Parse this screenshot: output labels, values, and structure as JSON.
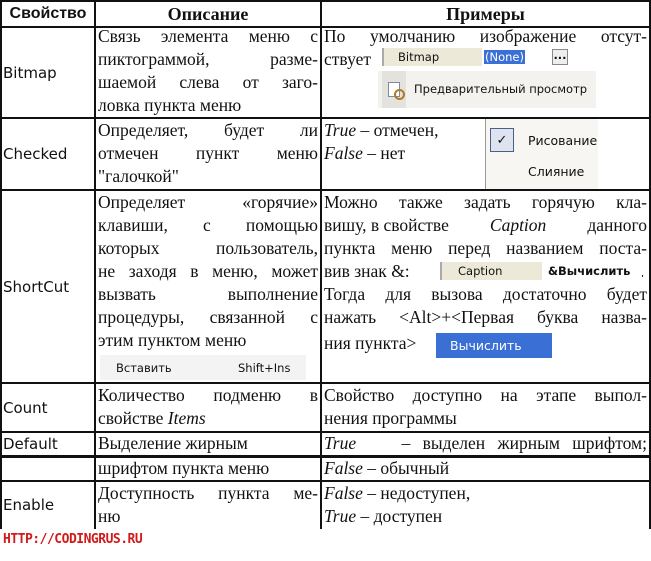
{
  "headers": {
    "property": "Свойство",
    "description": "Описание",
    "examples": "Примеры"
  },
  "rows": {
    "bitmap": {
      "property": "Bitmap",
      "desc": [
        "Связь элемента меню с",
        "пиктограммой, разме-",
        "шаемой слева от заго-",
        "ловка пункта меню"
      ],
      "ex": [
        "По умолчанию изображение отсут-",
        "ствует"
      ],
      "grid_label": "Bitmap",
      "grid_value": "(None)",
      "grid_button": "...",
      "menu_item": "Предварительный просмотр"
    },
    "checked": {
      "property": "Checked",
      "desc": [
        "Определяет, будет ли",
        "отмечен пункт меню",
        "\"галочкой\""
      ],
      "ex_true": "True",
      "ex_true_text": " – отмечен,",
      "ex_false": "False",
      "ex_false_text": " – нет",
      "menu_checked": "Рисование",
      "menu_other": "Слияние"
    },
    "shortcut": {
      "property": "ShortCut",
      "desc": [
        "Определяет «горячие»",
        "клавиши, с помощью",
        "которых пользователь,",
        "не заходя в меню, может",
        "вызвать выполнение",
        "процедуры, связанной с",
        "этим пунктом меню"
      ],
      "menu_item": "Вставить",
      "menu_shortcut": "Shift+Ins",
      "ex1": "Можно также задать горячую кла-",
      "ex2a": "вишу, в свойстве ",
      "ex2b": "Caption",
      "ex2c": " данного",
      "ex3": "пункта меню перед названием поста-",
      "ex4": "вив знак &:",
      "ex4_end": ".",
      "ex5": "Тогда для вызова достаточно будет",
      "ex6": "нажать <Alt>+<Первая буква назва-",
      "ex7": "ния пункта>",
      "caption_label": "Caption",
      "caption_value": "&Вычислить",
      "button": "Вычислить"
    },
    "count": {
      "property": "Count",
      "desc1": "Количество подменю в",
      "desc2a": "свойстве ",
      "desc2b": "Items",
      "ex": [
        "Свойство доступно на этапе выпол-",
        "нения программы"
      ]
    },
    "default": {
      "property": "Default",
      "desc1": "Выделение жирным",
      "desc2": "шрифтом пункта меню",
      "ex_true": "True",
      "ex_true_text": " – выделен жирным шрифтом;",
      "ex_false": "False",
      "ex_false_text": " – обычный"
    },
    "enable": {
      "property": "Enable",
      "desc1": "Доступность пункта ме-",
      "desc2": "ню",
      "ex_false": "False",
      "ex_false_text": " – недоступен,",
      "ex_true": "True",
      "ex_true_text": " – доступен"
    }
  },
  "watermark": "HTTP://CODINGRUS.RU",
  "colors": {
    "selection": "#3a6fd6",
    "watermark": "#d11a1a"
  }
}
